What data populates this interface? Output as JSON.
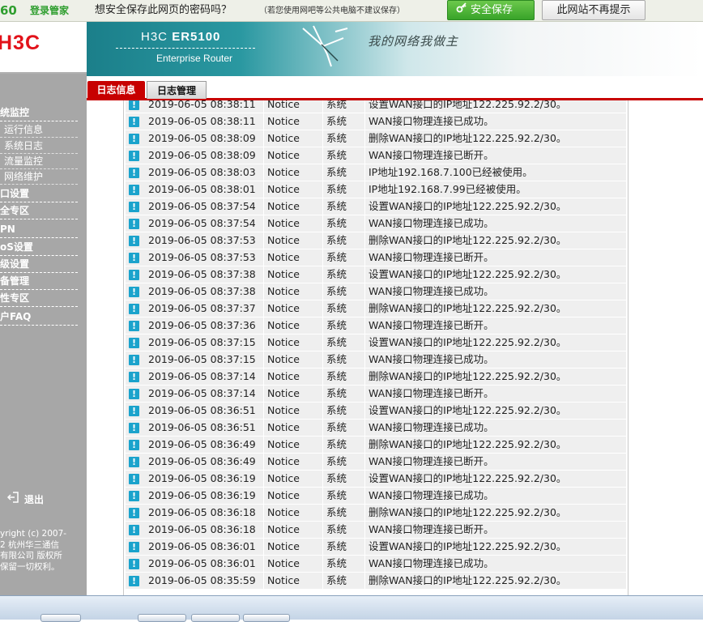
{
  "password_bar": {
    "logo": "60",
    "brand": "登录管家",
    "question": "想安全保存此网页的密码吗？",
    "note": "（若您使用网吧等公共电脑不建议保存）",
    "save_label": "安全保存",
    "never_label": "此网站不再提示",
    "save_icon": "key-icon"
  },
  "sidebar": {
    "logo": "H3C",
    "items": [
      {
        "label": "统监控",
        "type": "main"
      },
      {
        "label": "运行信息",
        "type": "sub"
      },
      {
        "label": "系统日志",
        "type": "sub"
      },
      {
        "label": "流量监控",
        "type": "sub"
      },
      {
        "label": "网络维护",
        "type": "sub"
      },
      {
        "label": "口设置",
        "type": "main"
      },
      {
        "label": "全专区",
        "type": "main"
      },
      {
        "label": "PN",
        "type": "main"
      },
      {
        "label": "oS设置",
        "type": "main"
      },
      {
        "label": "级设置",
        "type": "main"
      },
      {
        "label": "备管理",
        "type": "main"
      },
      {
        "label": "性专区",
        "type": "main"
      },
      {
        "label": "户FAQ",
        "type": "main"
      }
    ],
    "logout_label": "退出",
    "copyright": [
      "yright (c) 2007-",
      "2  杭州华三通信",
      "有限公司 版权所",
      "保留一切权利。"
    ]
  },
  "banner": {
    "title_prefix": "H3C",
    "title_model": "ER5100",
    "subtitle": "Enterprise Router",
    "slogan": "我的网络我做主"
  },
  "tabs": [
    {
      "label": "日志信息",
      "active": true
    },
    {
      "label": "日志管理",
      "active": false
    }
  ],
  "log": {
    "rows": [
      {
        "time": "2019-06-05 08:38:11",
        "level": "Notice",
        "type": "系统",
        "message": "设置WAN接口的IP地址122.225.92.2/30。"
      },
      {
        "time": "2019-06-05 08:38:11",
        "level": "Notice",
        "type": "系统",
        "message": "WAN接口物理连接已成功。"
      },
      {
        "time": "2019-06-05 08:38:09",
        "level": "Notice",
        "type": "系统",
        "message": "删除WAN接口的IP地址122.225.92.2/30。"
      },
      {
        "time": "2019-06-05 08:38:09",
        "level": "Notice",
        "type": "系统",
        "message": "WAN接口物理连接已断开。"
      },
      {
        "time": "2019-06-05 08:38:03",
        "level": "Notice",
        "type": "系统",
        "message": "IP地址192.168.7.100已经被使用。"
      },
      {
        "time": "2019-06-05 08:38:01",
        "level": "Notice",
        "type": "系统",
        "message": "IP地址192.168.7.99已经被使用。"
      },
      {
        "time": "2019-06-05 08:37:54",
        "level": "Notice",
        "type": "系统",
        "message": "设置WAN接口的IP地址122.225.92.2/30。"
      },
      {
        "time": "2019-06-05 08:37:54",
        "level": "Notice",
        "type": "系统",
        "message": "WAN接口物理连接已成功。"
      },
      {
        "time": "2019-06-05 08:37:53",
        "level": "Notice",
        "type": "系统",
        "message": "删除WAN接口的IP地址122.225.92.2/30。"
      },
      {
        "time": "2019-06-05 08:37:53",
        "level": "Notice",
        "type": "系统",
        "message": "WAN接口物理连接已断开。"
      },
      {
        "time": "2019-06-05 08:37:38",
        "level": "Notice",
        "type": "系统",
        "message": "设置WAN接口的IP地址122.225.92.2/30。"
      },
      {
        "time": "2019-06-05 08:37:38",
        "level": "Notice",
        "type": "系统",
        "message": "WAN接口物理连接已成功。"
      },
      {
        "time": "2019-06-05 08:37:37",
        "level": "Notice",
        "type": "系统",
        "message": "删除WAN接口的IP地址122.225.92.2/30。"
      },
      {
        "time": "2019-06-05 08:37:36",
        "level": "Notice",
        "type": "系统",
        "message": "WAN接口物理连接已断开。"
      },
      {
        "time": "2019-06-05 08:37:15",
        "level": "Notice",
        "type": "系统",
        "message": "设置WAN接口的IP地址122.225.92.2/30。"
      },
      {
        "time": "2019-06-05 08:37:15",
        "level": "Notice",
        "type": "系统",
        "message": "WAN接口物理连接已成功。"
      },
      {
        "time": "2019-06-05 08:37:14",
        "level": "Notice",
        "type": "系统",
        "message": "删除WAN接口的IP地址122.225.92.2/30。"
      },
      {
        "time": "2019-06-05 08:37:14",
        "level": "Notice",
        "type": "系统",
        "message": "WAN接口物理连接已断开。"
      },
      {
        "time": "2019-06-05 08:36:51",
        "level": "Notice",
        "type": "系统",
        "message": "设置WAN接口的IP地址122.225.92.2/30。"
      },
      {
        "time": "2019-06-05 08:36:51",
        "level": "Notice",
        "type": "系统",
        "message": "WAN接口物理连接已成功。"
      },
      {
        "time": "2019-06-05 08:36:49",
        "level": "Notice",
        "type": "系统",
        "message": "删除WAN接口的IP地址122.225.92.2/30。"
      },
      {
        "time": "2019-06-05 08:36:49",
        "level": "Notice",
        "type": "系统",
        "message": "WAN接口物理连接已断开。"
      },
      {
        "time": "2019-06-05 08:36:19",
        "level": "Notice",
        "type": "系统",
        "message": "设置WAN接口的IP地址122.225.92.2/30。"
      },
      {
        "time": "2019-06-05 08:36:19",
        "level": "Notice",
        "type": "系统",
        "message": "WAN接口物理连接已成功。"
      },
      {
        "time": "2019-06-05 08:36:18",
        "level": "Notice",
        "type": "系统",
        "message": "删除WAN接口的IP地址122.225.92.2/30。"
      },
      {
        "time": "2019-06-05 08:36:18",
        "level": "Notice",
        "type": "系统",
        "message": "WAN接口物理连接已断开。"
      },
      {
        "time": "2019-06-05 08:36:01",
        "level": "Notice",
        "type": "系统",
        "message": "设置WAN接口的IP地址122.225.92.2/30。"
      },
      {
        "time": "2019-06-05 08:36:01",
        "level": "Notice",
        "type": "系统",
        "message": "WAN接口物理连接已成功。"
      },
      {
        "time": "2019-06-05 08:35:59",
        "level": "Notice",
        "type": "系统",
        "message": "删除WAN接口的IP地址122.225.92.2/30。"
      }
    ]
  },
  "colors": {
    "accent_red": "#c70000",
    "sidebar_gray": "#a7a7a7",
    "notice_icon_blue": "#1ba3cc",
    "save_green": "#38a329"
  }
}
